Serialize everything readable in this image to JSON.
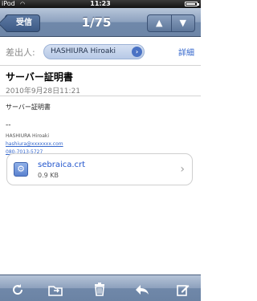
{
  "status_bar": {
    "carrier": "iPod",
    "time": "11:23",
    "battery_level": 0.9
  },
  "nav": {
    "back_label": "受信",
    "title": "1/75",
    "prev_icon": "up-arrow-icon",
    "next_icon": "down-arrow-icon"
  },
  "message": {
    "from_label": "差出人:",
    "sender": "HASHIURA Hiroaki",
    "details_link": "詳細",
    "subject": "サーバー証明書",
    "date": "2010年9月28日11:21",
    "body": "サーバー証明書",
    "signature_separator": "--",
    "signature_name": "HASHIURA Hiroaki",
    "signature_email": "hashiura@xxxxxxx.com",
    "signature_phone": "080-7013-5727"
  },
  "attachment": {
    "name": "sebraica.crt",
    "size": "0.9 KB",
    "icon": "certificate-file-icon"
  },
  "toolbar": {
    "items": [
      "refresh-icon",
      "move-folder-icon",
      "trash-icon",
      "reply-icon",
      "compose-icon"
    ]
  },
  "colors": {
    "nav_bar": "#7e94b5",
    "link": "#3366cc",
    "sender_chip": "#c7d6ee"
  }
}
